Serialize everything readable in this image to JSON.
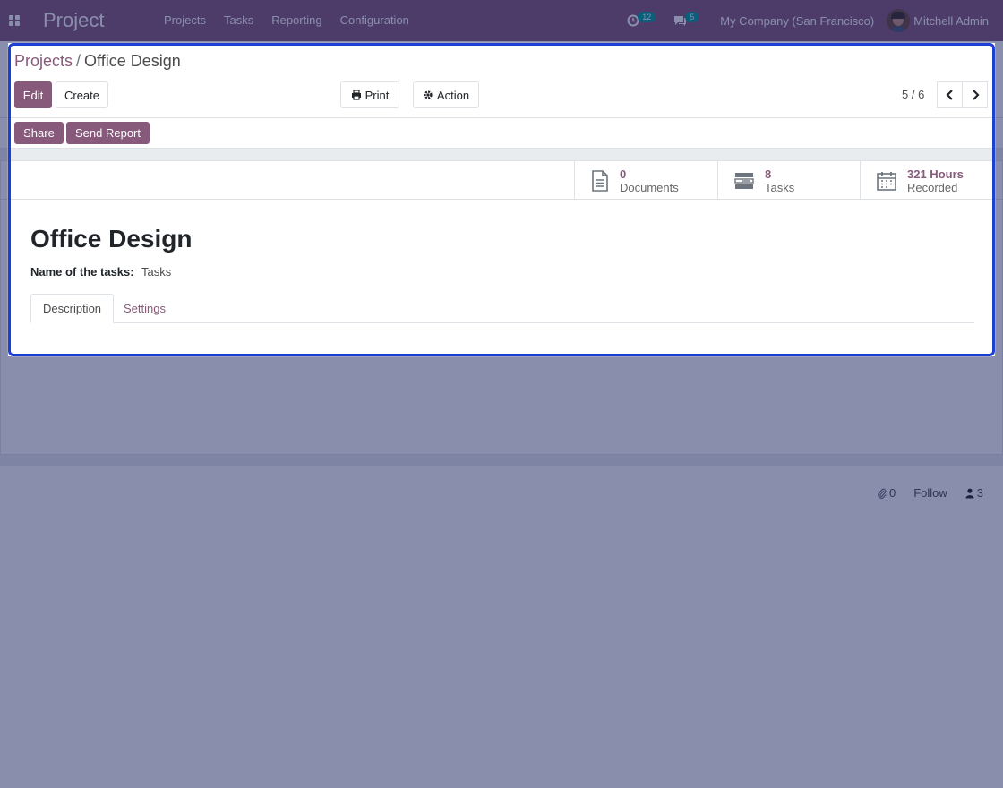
{
  "navbar": {
    "app_name": "Project",
    "menu": [
      "Projects",
      "Tasks",
      "Reporting",
      "Configuration"
    ],
    "activity_count": "12",
    "message_count": "5",
    "company": "My Company (San Francisco)",
    "user": "Mitchell Admin"
  },
  "breadcrumb": {
    "parent": "Projects",
    "sep": "/",
    "current": "Office Design"
  },
  "buttons": {
    "edit": "Edit",
    "create": "Create",
    "print": "Print",
    "action": "Action",
    "share": "Share",
    "send_report": "Send Report"
  },
  "pager": {
    "value": "5 / 6"
  },
  "stats": {
    "documents": {
      "value": "0",
      "label": "Documents"
    },
    "tasks": {
      "value": "8",
      "label": "Tasks"
    },
    "hours": {
      "value": "321 Hours",
      "label": "Recorded"
    }
  },
  "form": {
    "title": "Office Design",
    "field_label": "Name of the tasks:",
    "field_value": "Tasks",
    "tabs": [
      "Description",
      "Settings"
    ]
  },
  "chatter": {
    "attachments": "0",
    "follow": "Follow",
    "followers": "3"
  },
  "colors": {
    "brand": "#875a7b",
    "accent": "#00a09d",
    "highlight": "#1e3fd4"
  }
}
